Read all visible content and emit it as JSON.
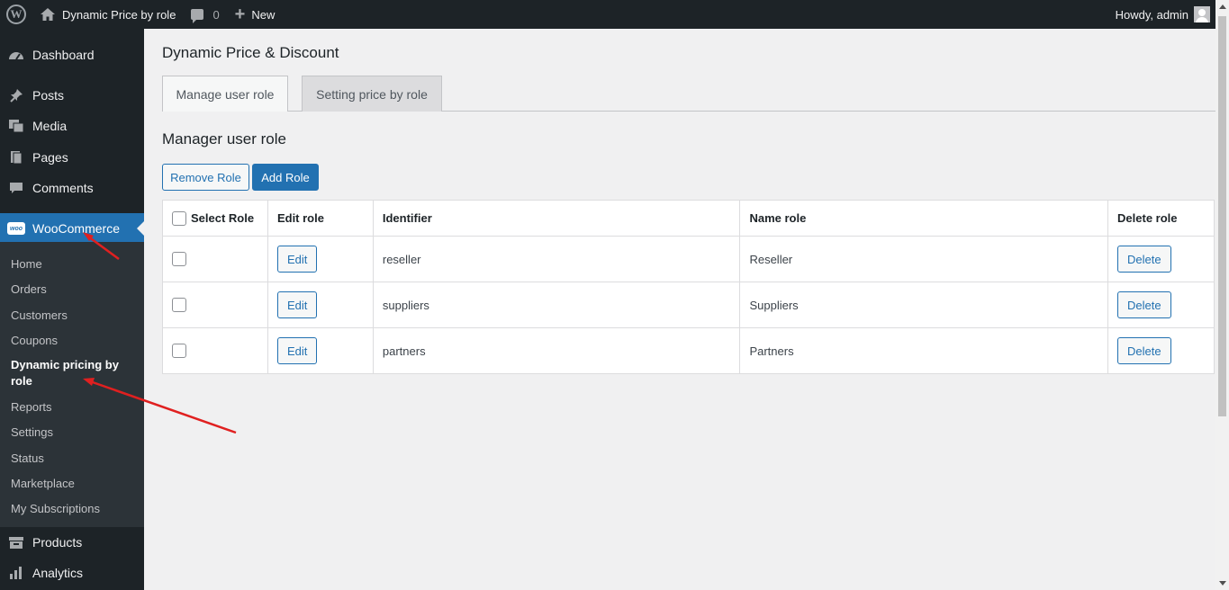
{
  "admin_bar": {
    "site_name": "Dynamic Price by role",
    "comments_count": "0",
    "new_label": "New",
    "howdy": "Howdy, admin"
  },
  "sidebar": {
    "items": [
      {
        "label": "Dashboard",
        "icon": "dashboard-icon"
      },
      {
        "label": "Posts",
        "icon": "pin-icon"
      },
      {
        "label": "Media",
        "icon": "media-icon"
      },
      {
        "label": "Pages",
        "icon": "pages-icon"
      },
      {
        "label": "Comments",
        "icon": "comment-icon"
      },
      {
        "label": "WooCommerce",
        "icon": "woo-icon"
      },
      {
        "label": "Products",
        "icon": "archive-icon"
      },
      {
        "label": "Analytics",
        "icon": "chart-bar-icon"
      }
    ],
    "woo_badge": "woo",
    "submenu": [
      "Home",
      "Orders",
      "Customers",
      "Coupons",
      "Dynamic pricing by role",
      "Reports",
      "Settings",
      "Status",
      "Marketplace",
      "My Subscriptions"
    ]
  },
  "page": {
    "title": "Dynamic Price & Discount",
    "tabs": [
      "Manage user role",
      "Setting price by role"
    ],
    "section_title": "Manager user role",
    "remove_role": "Remove Role",
    "add_role": "Add Role",
    "table": {
      "headers": [
        "Select Role",
        "Edit role",
        "Identifier",
        "Name role",
        "Delete role"
      ],
      "rows": [
        {
          "edit": "Edit",
          "identifier": "reseller",
          "name": "Reseller",
          "delete": "Delete"
        },
        {
          "edit": "Edit",
          "identifier": "suppliers",
          "name": "Suppliers",
          "delete": "Delete"
        },
        {
          "edit": "Edit",
          "identifier": "partners",
          "name": "Partners",
          "delete": "Delete"
        }
      ]
    }
  },
  "colors": {
    "admin_dark": "#1d2327",
    "submenu_bg": "#2c3338",
    "accent": "#2271b1",
    "annotation_arrow": "#e02020"
  }
}
